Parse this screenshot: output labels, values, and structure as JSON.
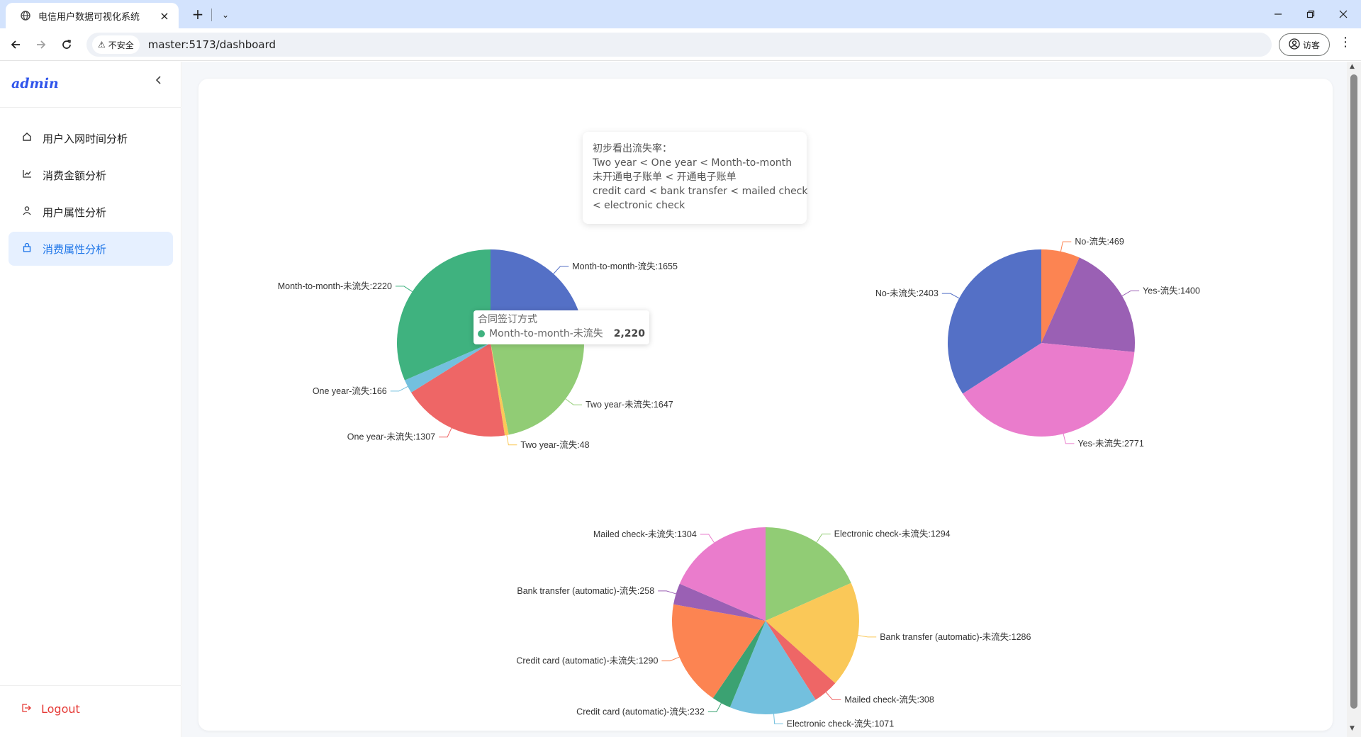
{
  "browser": {
    "tab_title": "电信用户数据可视化系统",
    "tab_close": "×",
    "new_tab": "+",
    "tab_menu": "⌄",
    "secure_label": "不安全",
    "url": "master:5173/dashboard",
    "guest_label": "访客"
  },
  "sidebar": {
    "brand": "admin",
    "items": [
      {
        "label": "用户入网时间分析",
        "icon": "home-icon"
      },
      {
        "label": "消费金额分析",
        "icon": "line-chart-icon"
      },
      {
        "label": "用户属性分析",
        "icon": "user-icon"
      },
      {
        "label": "消费属性分析",
        "icon": "lock-icon",
        "active": true
      }
    ],
    "logout": "Logout"
  },
  "note": {
    "lines": [
      "初步看出流失率：",
      "Two year < One year < Month-to-month",
      "未开通电子账单 < 开通电子账单",
      "credit card < bank transfer < mailed check",
      "< electronic check"
    ]
  },
  "tooltip": {
    "title": "合同签订方式",
    "series": "Month-to-month-未流失",
    "value": "2,220",
    "color": "#3fb27f"
  },
  "chart_data": [
    {
      "type": "pie",
      "title": "合同签订方式",
      "slices": [
        {
          "label": "Month-to-month-流失",
          "value": 1655,
          "color": "#5470c6"
        },
        {
          "label": "Two year-未流失",
          "value": 1647,
          "color": "#91cc75"
        },
        {
          "label": "Two year-流失",
          "value": 48,
          "color": "#fac858"
        },
        {
          "label": "One year-未流失",
          "value": 1307,
          "color": "#ee6666"
        },
        {
          "label": "One year-流失",
          "value": 166,
          "color": "#73c0de"
        },
        {
          "label": "Month-to-month-未流失",
          "value": 2220,
          "color": "#3fb27f"
        }
      ]
    },
    {
      "type": "pie",
      "slices": [
        {
          "label": "No-流失",
          "value": 469,
          "color": "#fc8452"
        },
        {
          "label": "Yes-流失",
          "value": 1400,
          "color": "#9a60b4"
        },
        {
          "label": "Yes-未流失",
          "value": 2771,
          "color": "#ea7ccc"
        },
        {
          "label": "No-未流失",
          "value": 2403,
          "color": "#5470c6"
        }
      ]
    },
    {
      "type": "pie",
      "slices": [
        {
          "label": "Electronic check-未流失",
          "value": 1294,
          "color": "#91cc75"
        },
        {
          "label": "Bank transfer (automatic)-未流失",
          "value": 1286,
          "color": "#fac858"
        },
        {
          "label": "Mailed check-流失",
          "value": 308,
          "color": "#ee6666"
        },
        {
          "label": "Electronic check-流失",
          "value": 1071,
          "color": "#73c0de"
        },
        {
          "label": "Credit card (automatic)-流失",
          "value": 232,
          "color": "#3ba272"
        },
        {
          "label": "Credit card (automatic)-未流失",
          "value": 1290,
          "color": "#fc8452"
        },
        {
          "label": "Bank transfer (automatic)-流失",
          "value": 258,
          "color": "#9a60b4"
        },
        {
          "label": "Mailed check-未流失",
          "value": 1304,
          "color": "#ea7ccc"
        }
      ]
    }
  ]
}
